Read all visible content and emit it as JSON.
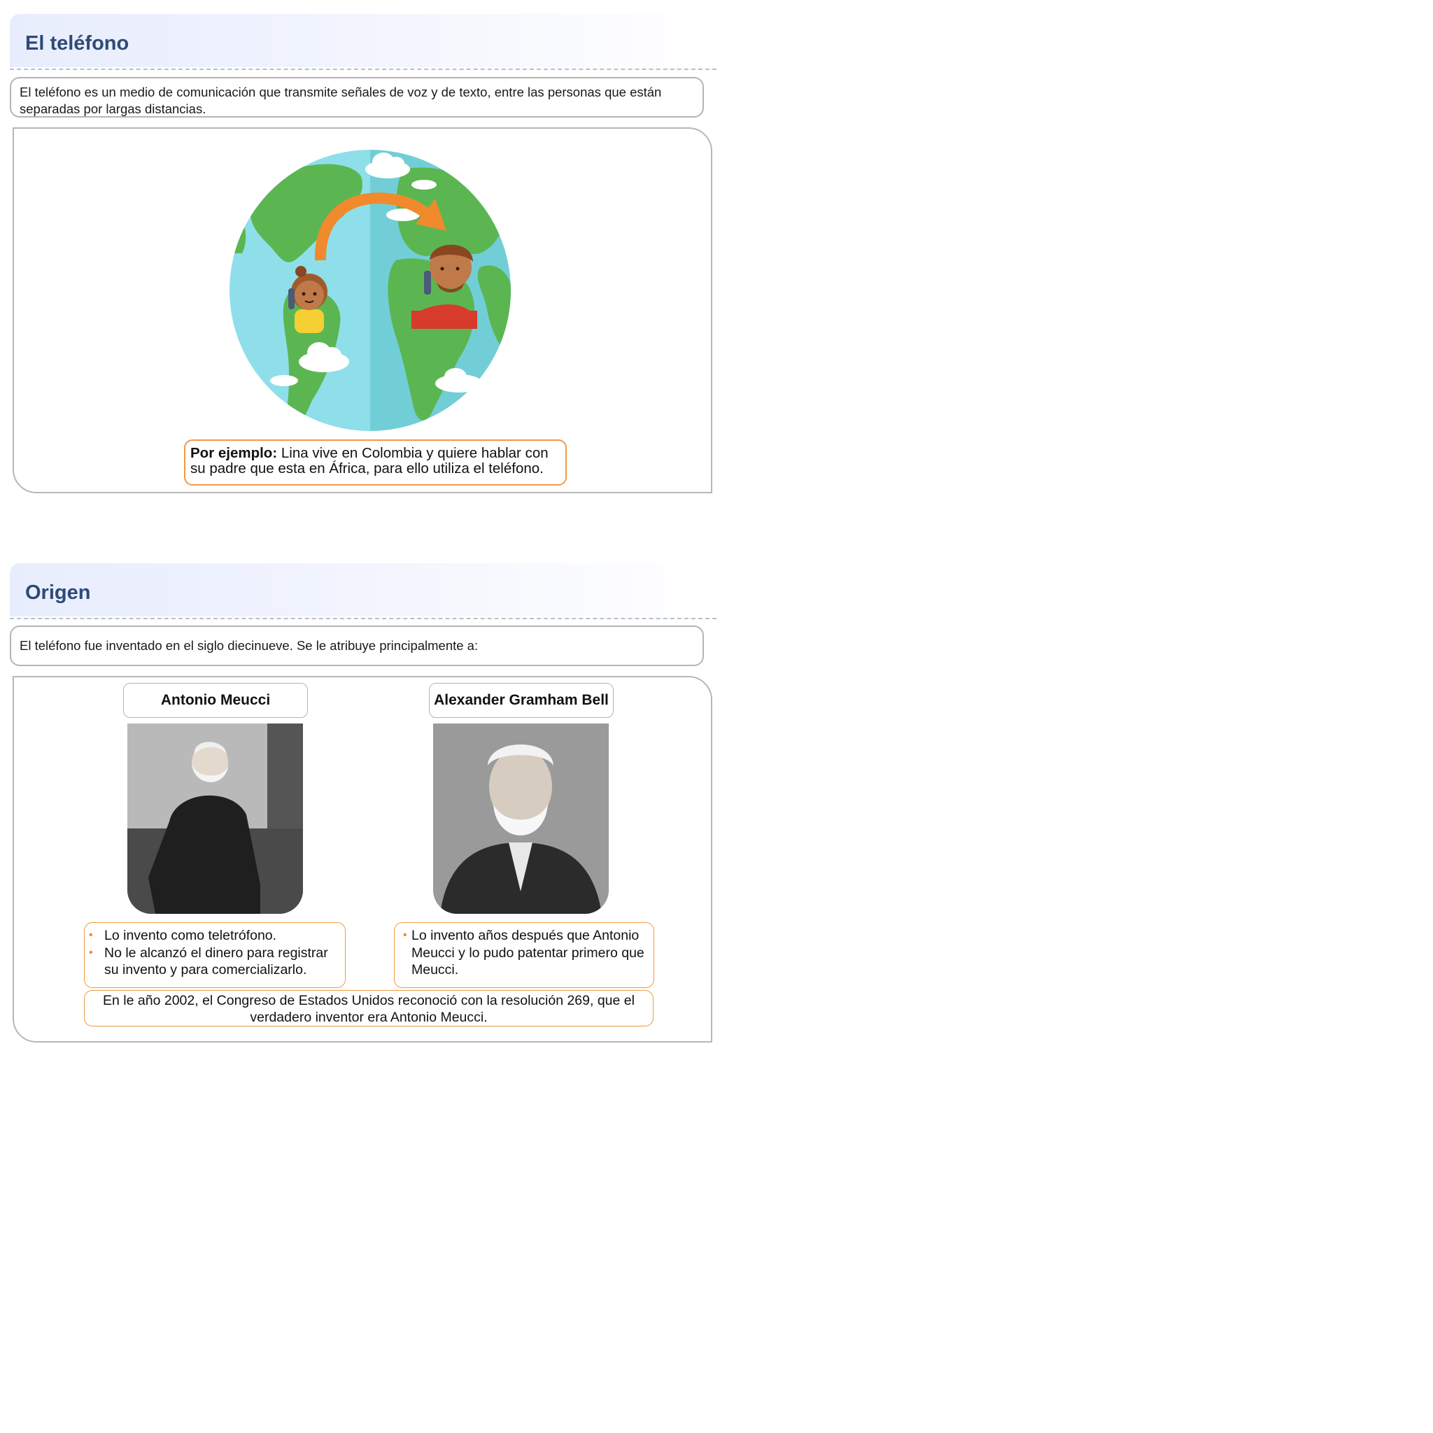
{
  "section1": {
    "title": "El teléfono",
    "intro": "El teléfono es un medio de comunicación que transmite señales de voz y de texto, entre las personas que están separadas por largas distancias.",
    "example_label": "Por ejemplo:",
    "example_text": " Lina vive en Colombia y quiere hablar con su padre que esta en África, para ello utiliza el teléfono."
  },
  "section2": {
    "title": "Origen",
    "intro": "El teléfono fue inventado en el siglo diecinueve. Se le atribuye principalmente a:",
    "inventors": [
      {
        "name": "Antonio Meucci",
        "notes": [
          "Lo invento como teletrófono.",
          "No le alcanzó el dinero para registrar su invento y para comercializarlo."
        ]
      },
      {
        "name": "Alexander Gramham Bell",
        "notes": [
          "Lo invento años después que Antonio Meucci y lo pudo patentar primero que Meucci."
        ]
      }
    ],
    "footer": "En le año 2002, el Congreso de Estados Unidos reconoció con la resolución 269, que el verdadero inventor era Antonio Meucci."
  },
  "colors": {
    "title": "#2e4a78",
    "accent_orange": "#ef9a45",
    "border_gray": "#b5b5b5",
    "ocean": "#8fdfea",
    "land": "#5bb652"
  }
}
